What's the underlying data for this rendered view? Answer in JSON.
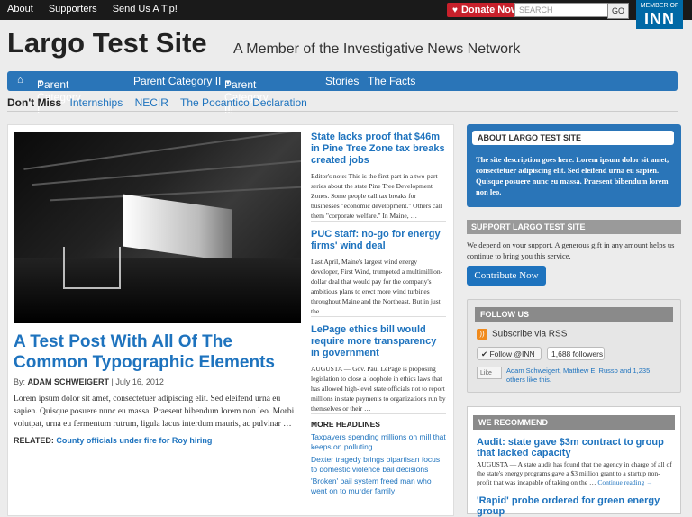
{
  "topbar": {
    "links": [
      "About",
      "Supporters",
      "Send Us A Tip!"
    ],
    "donate_label": "Donate Now",
    "search_placeholder": "SEARCH",
    "go_label": "GO",
    "inn_member": "MEMBER OF",
    "inn_logo": "INN"
  },
  "site": {
    "title": "Largo Test Site",
    "tagline": "A Member of the Investigative News Network"
  },
  "nav": {
    "items": [
      "Parent Category I",
      "Parent Category II",
      "Parent Category III",
      "Stories",
      "The Facts"
    ]
  },
  "dont_miss": {
    "label": "Don't Miss",
    "links": [
      "Internships",
      "NECIR",
      "The Pocantico Declaration"
    ]
  },
  "lead_story": {
    "title": "A Test Post With All Of The Common Typographic Elements",
    "byline_prefix": "By:",
    "author": "ADAM SCHWEIGERT",
    "date": "| July 16, 2012",
    "excerpt": "Lorem ipsum dolor sit amet, consectetuer adipiscing elit. Sed eleifend urna eu sapien. Quisque posuere nunc eu massa. Praesent bibendum lorem non leo. Morbi volutpat, urna eu fermentum rutrum, ligula lacus interdum mauris, ac pulvinar …",
    "related_label": "RELATED:",
    "related_link": "County officials under fire for Roy hiring"
  },
  "stories": [
    {
      "headline": "State lacks proof that $46m in Pine Tree Zone tax breaks created jobs",
      "text": "Editor's note: This is the first part in a two-part series about the state Pine Tree Development Zones.   Some people call tax breaks for businesses \"economic development.\" Others call them \"corporate welfare.\" In Maine, …"
    },
    {
      "headline": "PUC staff: no-go for energy firms' wind deal",
      "text": "Last April, Maine's largest wind energy developer, First Wind, trumpeted a multimillion-dollar deal that would pay for the company's ambitious plans to erect more wind turbines throughout Maine and the Northeast. But in just the …"
    },
    {
      "headline": "LePage ethics bill would require more transparency in government",
      "text": "AUGUSTA — Gov. Paul LePage is proposing legislation to close a loophole in ethics laws that has allowed high-level state officials not to report millions in state payments to organizations run by themselves or their …"
    }
  ],
  "more_headlines": {
    "label": "MORE HEADLINES",
    "items": [
      "Taxpayers spending millions on mill that keeps on polluting",
      "Dexter tragedy brings bipartisan focus to domestic violence bail decisions",
      "'Broken' bail system freed man who went on to murder family"
    ]
  },
  "sidebar": {
    "about_title": "ABOUT LARGO TEST SITE",
    "about_text": "The site description goes here. Lorem ipsum dolor sit amet, consectetuer adipiscing elit. Sed eleifend urna eu sapien. Quisque posuere nunc eu massa. Praesent bibendum lorem non leo.",
    "support_title": "SUPPORT LARGO TEST SITE",
    "support_text": "We depend on your support. A generous gift in any amount helps us continue to bring you this service.",
    "contribute_label": "Contribute Now",
    "follow_title": "FOLLOW US",
    "rss_label": "Subscribe via RSS",
    "twitter_label": "Follow @INN",
    "twitter_count": "1,688 followers",
    "fb_like": "Like",
    "fb_names": "Adam Schweigert, Matthew E. Russo",
    "fb_rest": " and 1,235 others like this.",
    "recommend_title": "WE RECOMMEND",
    "rec1_title": "Audit: state gave $3m contract to group that lacked capacity",
    "rec1_text": "AUGUSTA — A state audit has found that the agency in charge of all of the state's energy programs gave a $3 million grant to a startup non-profit that was incapable of taking on the …",
    "rec1_more": "Continue reading →",
    "rec2_title": "'Rapid' probe ordered for green energy group"
  }
}
